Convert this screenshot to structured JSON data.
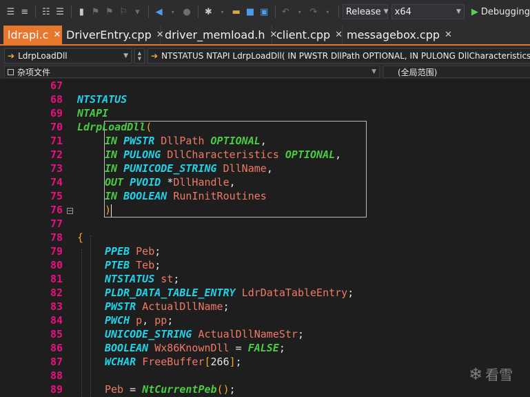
{
  "toolbar": {
    "config": "Release",
    "platform": "x64",
    "debug_label": "Debugging"
  },
  "tabs": [
    {
      "label": "ldrapi.c",
      "active": true
    },
    {
      "label": "DriverEntry.cpp"
    },
    {
      "label": "driver_memload.h"
    },
    {
      "label": "client.cpp"
    },
    {
      "label": "messagebox.cpp"
    }
  ],
  "nav": {
    "function_combo": "LdrpLoadDll",
    "signature": "NTSTATUS NTAPI LdrpLoadDll( IN PWSTR DllPath OPTIONAL, IN PULONG DllCharacteristics",
    "file_scope": "杂项文件",
    "global_scope": "(全局范围)"
  },
  "line_numbers": [
    "67",
    "68",
    "69",
    "70",
    "71",
    "72",
    "73",
    "74",
    "75",
    "76",
    "77",
    "78",
    "79",
    "80",
    "81",
    "82",
    "83",
    "84",
    "85",
    "86",
    "87",
    "88",
    "89"
  ],
  "code": {
    "l68": "NTSTATUS",
    "l69": "NTAPI",
    "l70_name": "LdrpLoadDll",
    "l70_paren": "(",
    "l71_in": "IN",
    "l71_type": "PWSTR",
    "l71_name": "DllPath",
    "l71_opt": "OPTIONAL",
    "l72_in": "IN",
    "l72_type": "PULONG",
    "l72_name": "DllCharacteristics",
    "l72_opt": "OPTIONAL",
    "l73_in": "IN",
    "l73_type": "PUNICODE_STRING",
    "l73_name": "DllName",
    "l74_out": "OUT",
    "l74_type": "PVOID",
    "l74_star": "*",
    "l74_name": "DllHandle",
    "l75_in": "IN",
    "l75_type": "BOOLEAN",
    "l75_name": "RunInitRoutines",
    "l76_paren": ")",
    "l78_brace": "{",
    "l79_type": "PPEB",
    "l79_name": "Peb",
    "l80_type": "PTEB",
    "l80_name": "Teb",
    "l81_type": "NTSTATUS",
    "l81_name": "st",
    "l82_type": "PLDR_DATA_TABLE_ENTRY",
    "l82_name": "LdrDataTableEntry",
    "l83_type": "PWSTR",
    "l83_name": "ActualDllName",
    "l84_type": "PWCH",
    "l84_name1": "p",
    "l84_name2": "pp",
    "l85_type": "UNICODE_STRING",
    "l85_name": "ActualDllNameStr",
    "l86_type": "BOOLEAN",
    "l86_name": "Wx86KnownDll",
    "l86_eq": "=",
    "l86_val": "FALSE",
    "l87_type": "WCHAR",
    "l87_name": "FreeBuffer",
    "l87_lb": "[",
    "l87_num": "266",
    "l87_rb": "]",
    "l89_name": "Peb",
    "l89_eq": "=",
    "l89_fn": "NtCurrentPeb",
    "l89_parens": "()"
  },
  "watermark": "看雪",
  "colors": {
    "tab_active": "#e8772e",
    "line_number": "#e8117f",
    "keyword_cyan": "#22d2e8",
    "keyword_green": "#49cc42",
    "identifier": "#f07a63"
  }
}
